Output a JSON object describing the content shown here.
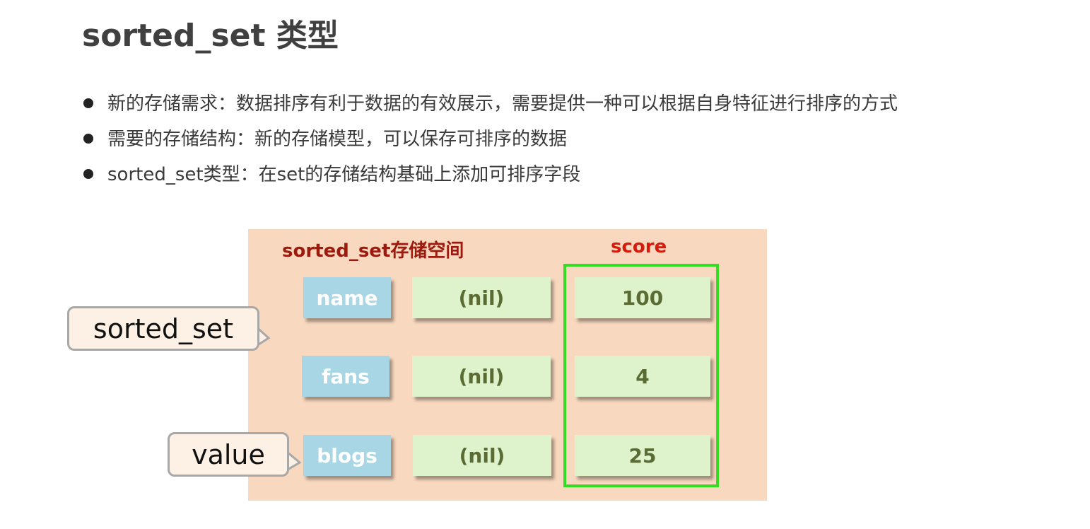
{
  "title": "sorted_set 类型",
  "bullets": [
    "新的存储需求：数据排序有利于数据的有效展示，需要提供一种可以根据自身特征进行排序的方式",
    "需要的存储结构：新的存储模型，可以保存可排序的数据",
    "sorted_set类型：在set的存储结构基础上添加可排序字段"
  ],
  "diagram": {
    "panel_title": "sorted_set存储空间",
    "score_label": "score",
    "rows": [
      {
        "field": "name",
        "value": "(nil)",
        "score": "100"
      },
      {
        "field": "fans",
        "value": "(nil)",
        "score": "4"
      },
      {
        "field": "blogs",
        "value": "(nil)",
        "score": "25"
      }
    ],
    "callout_key": "sorted_set",
    "callout_value": "value",
    "colors": {
      "panel_bg": "#f8d8be",
      "field_bg": "#a8d6e4",
      "value_bg": "#def2cc",
      "score_frame": "#33dd22",
      "panel_title": "#9c1a0e",
      "score_title": "#d41b0c"
    }
  }
}
